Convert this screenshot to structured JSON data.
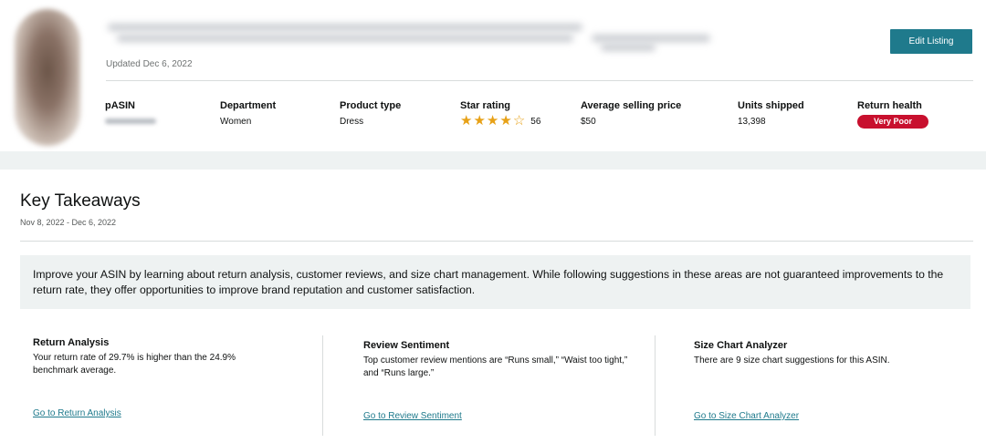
{
  "header": {
    "updated": "Updated Dec 6, 2022",
    "edit_button": "Edit Listing"
  },
  "meta": {
    "asin": {
      "label": "pASIN"
    },
    "department": {
      "label": "Department",
      "value": "Women"
    },
    "product_type": {
      "label": "Product type",
      "value": "Dress"
    },
    "star_rating": {
      "label": "Star rating",
      "rating": 4,
      "max": 5,
      "count": "56"
    },
    "avg_price": {
      "label": "Average selling price",
      "value": "$50"
    },
    "units_shipped": {
      "label": "Units shipped",
      "value": "13,398"
    },
    "return_health": {
      "label": "Return health",
      "value": "Very Poor",
      "color": "#c8102e"
    }
  },
  "key_takeaways": {
    "title": "Key Takeaways",
    "date_range": "Nov 8, 2022 - Dec 6, 2022",
    "intro": "Improve your ASIN by learning about return analysis, customer reviews, and size chart management. While following suggestions in these areas are not guaranteed improvements to the return rate, they offer opportunities to improve brand reputation and customer satisfaction."
  },
  "cards": [
    {
      "title": "Return Analysis",
      "body": "Your return rate of 29.7% is higher than the 24.9% benchmark average.",
      "link": "Go to Return Analysis"
    },
    {
      "title": "Review Sentiment",
      "body": "Top customer review mentions are “Runs small,” “Waist too tight,” and “Runs large.”",
      "link": "Go to Review Sentiment"
    },
    {
      "title": "Size Chart Analyzer",
      "body": "There are 9 size chart suggestions for this ASIN.",
      "link": "Go to Size Chart Analyzer"
    }
  ],
  "colors": {
    "accent": "#1f7a8c",
    "star": "#e7a117",
    "badge": "#c8102e",
    "band": "#eef2f2"
  }
}
